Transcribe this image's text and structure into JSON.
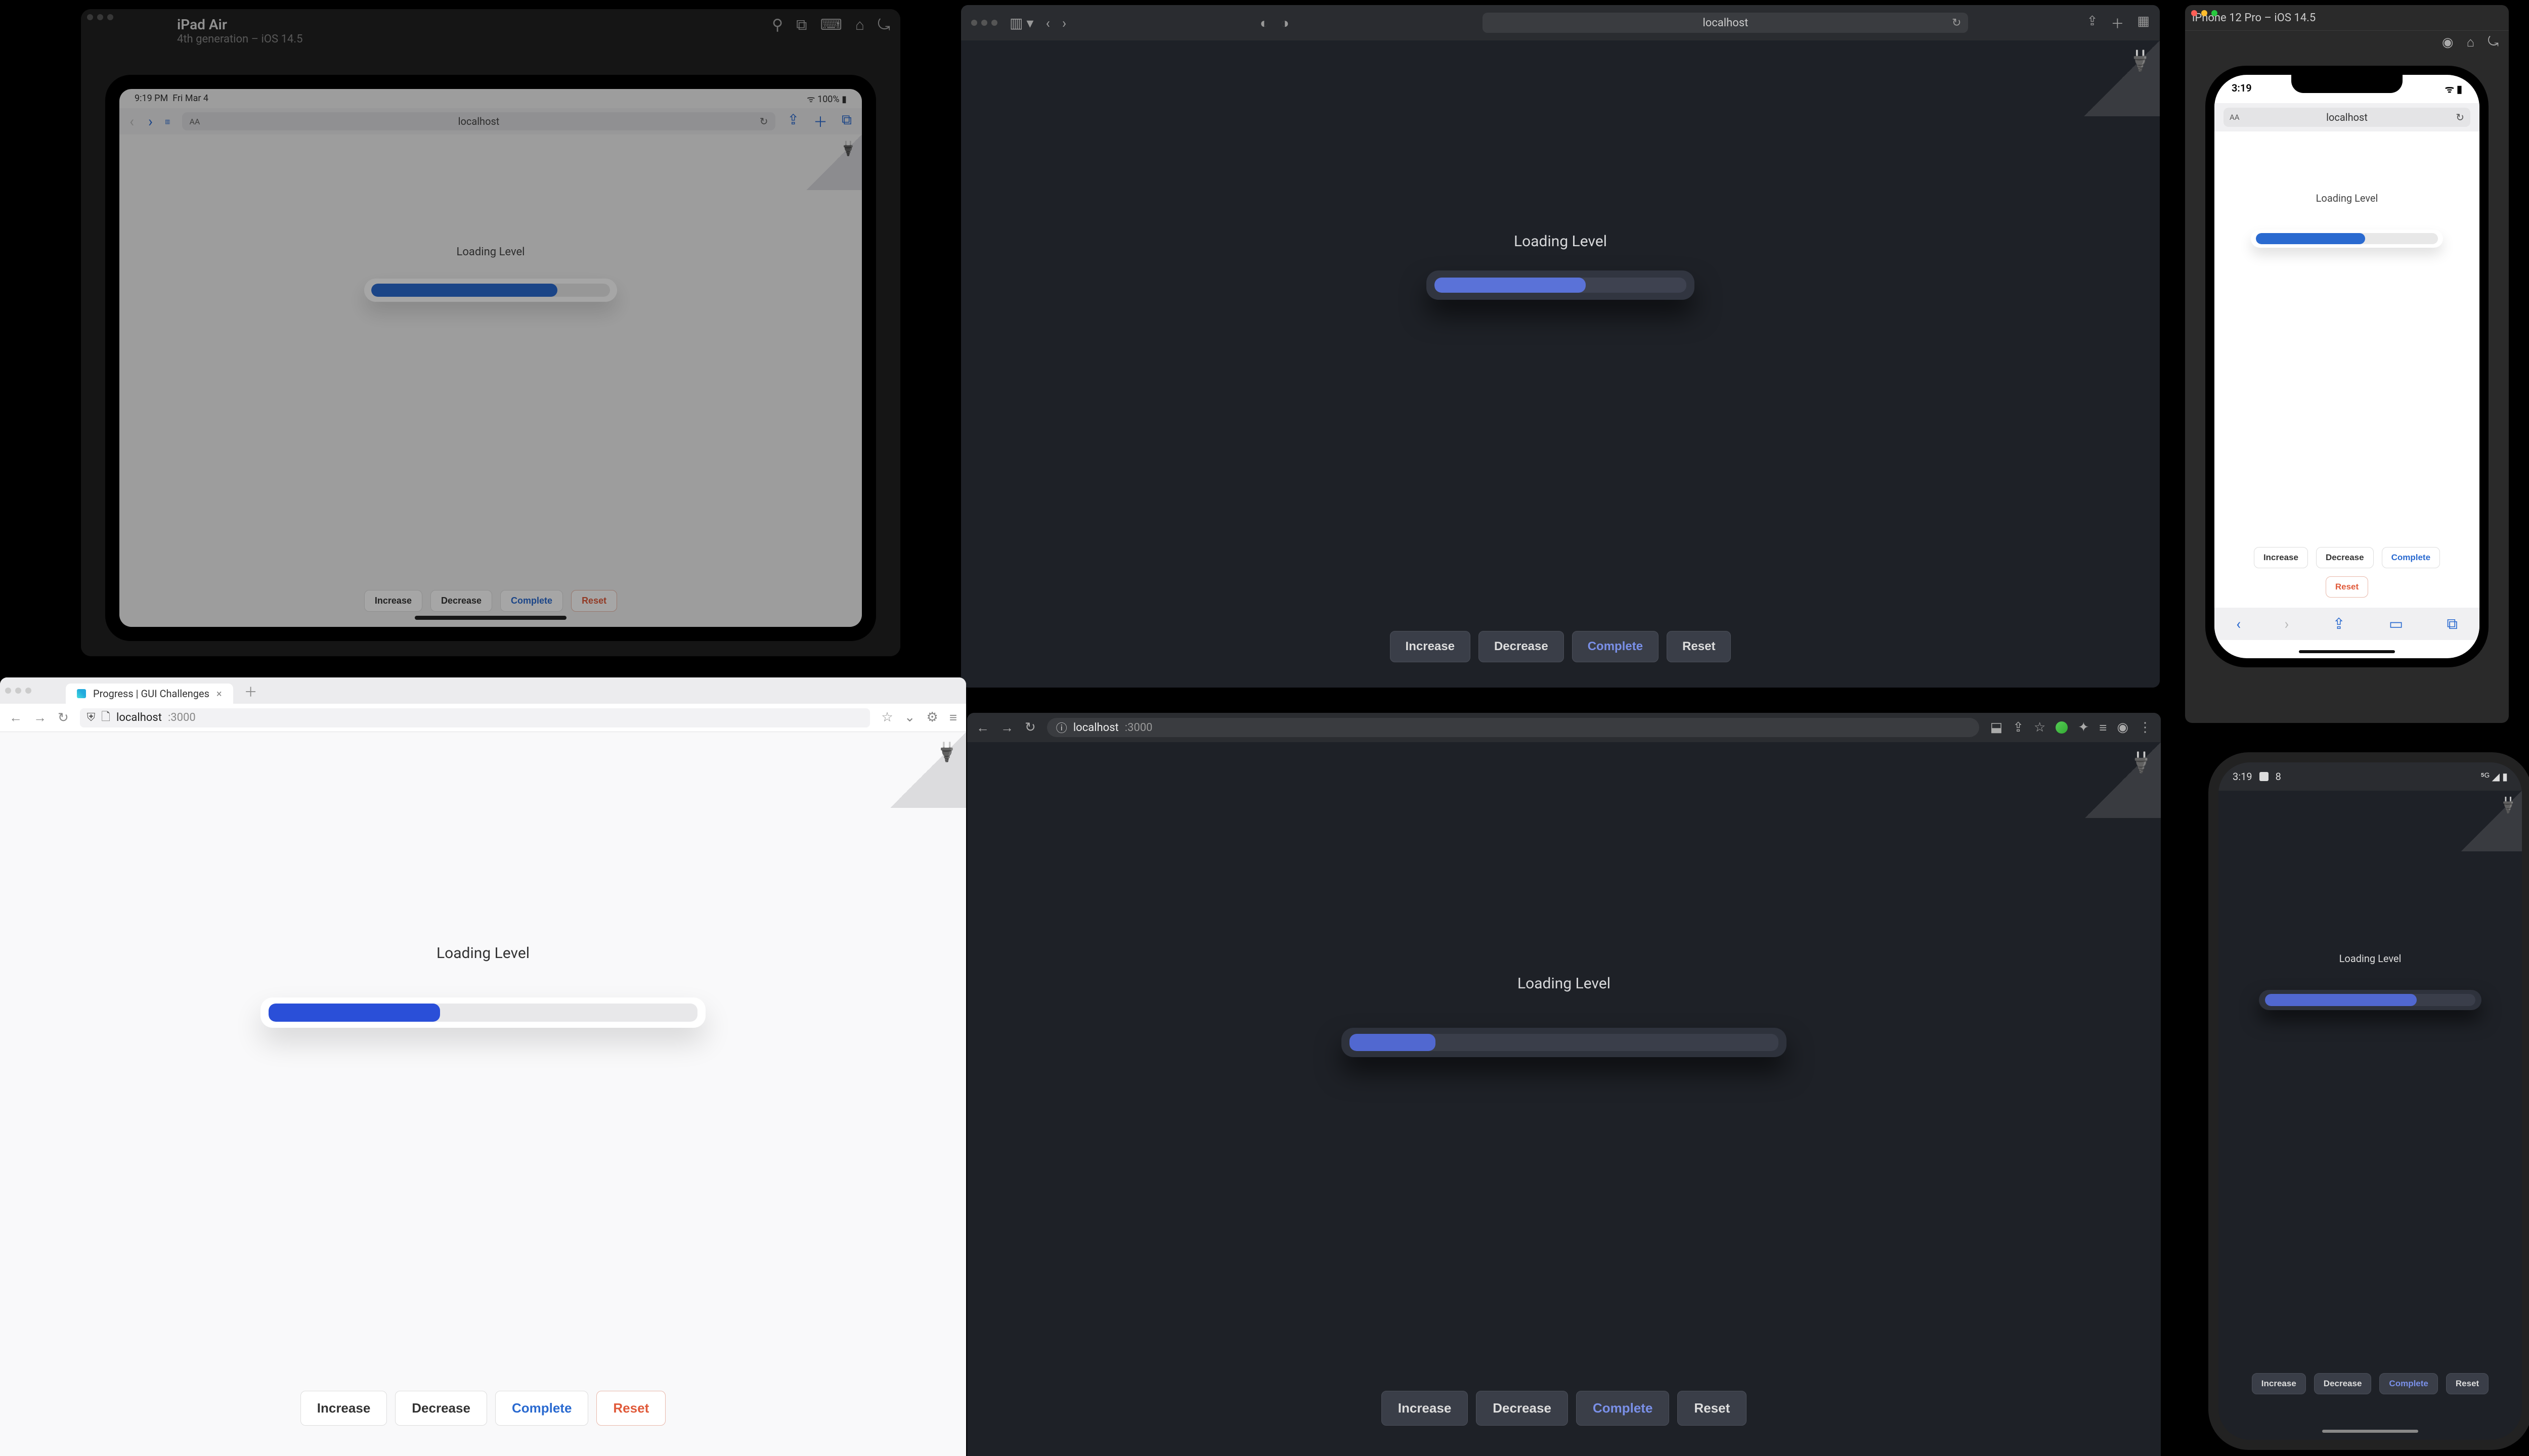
{
  "common": {
    "loading_label": "Loading Level",
    "buttons": {
      "increase": "Increase",
      "decrease": "Decrease",
      "complete": "Complete",
      "reset": "Reset"
    },
    "url_host": "localhost",
    "url_port": ":3000"
  },
  "ipad": {
    "window_title": "iPad Air",
    "window_subtitle": "4th generation – iOS 14.5",
    "status_time": "9:19 PM",
    "status_date": "Fri Mar 4",
    "status_right": "100%",
    "progress_pct": 78
  },
  "safari": {
    "progress_pct": 60
  },
  "iphone": {
    "window_title": "iPhone 12 Pro – iOS 14.5",
    "status_time": "3:19",
    "progress_pct": 60
  },
  "firefox": {
    "tab_title": "Progress | GUI Challenges",
    "progress_pct": 40
  },
  "chrome": {
    "progress_pct": 20
  },
  "android": {
    "status_time": "3:19",
    "status_icon_num": "8",
    "progress_pct": 72
  }
}
